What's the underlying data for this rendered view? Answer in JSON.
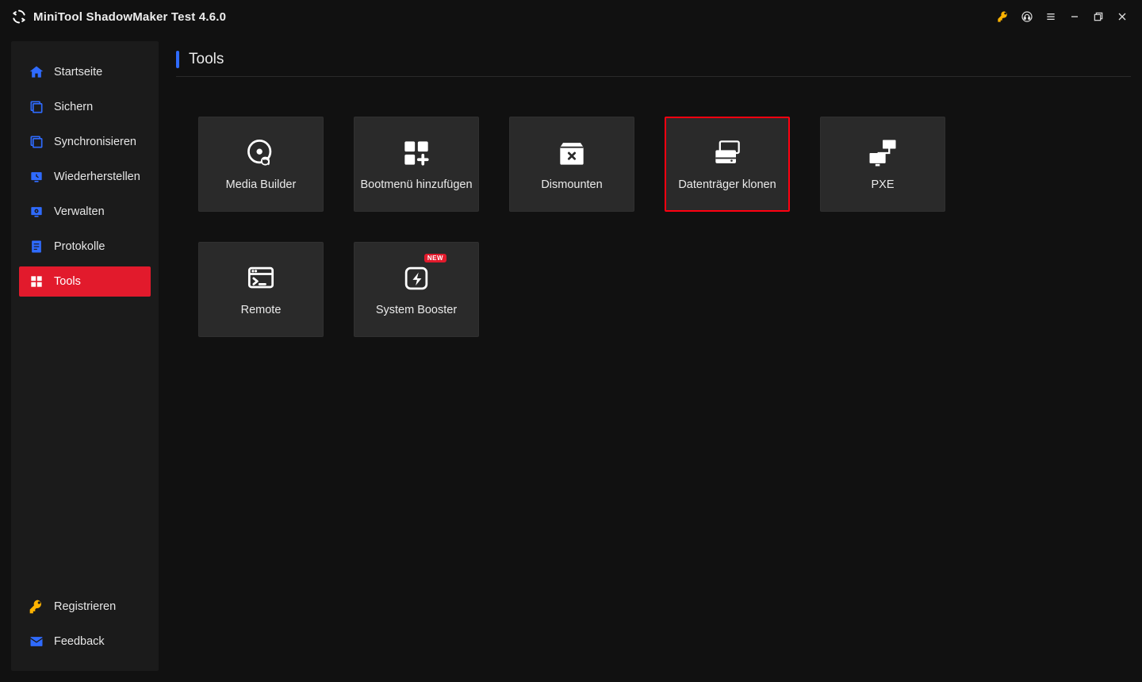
{
  "window": {
    "title": "MiniTool ShadowMaker Test 4.6.0"
  },
  "sidebar": {
    "items": [
      {
        "label": "Startseite"
      },
      {
        "label": "Sichern"
      },
      {
        "label": "Synchronisieren"
      },
      {
        "label": "Wiederherstellen"
      },
      {
        "label": "Verwalten"
      },
      {
        "label": "Protokolle"
      },
      {
        "label": "Tools"
      }
    ],
    "bottom": [
      {
        "label": "Registrieren"
      },
      {
        "label": "Feedback"
      }
    ]
  },
  "page": {
    "title": "Tools"
  },
  "tiles": [
    {
      "label": "Media Builder"
    },
    {
      "label": "Bootmenü hinzufügen"
    },
    {
      "label": "Dismounten"
    },
    {
      "label": "Datenträger klonen"
    },
    {
      "label": "PXE"
    },
    {
      "label": "Remote"
    },
    {
      "label": "System Booster",
      "badge": "NEW"
    }
  ]
}
